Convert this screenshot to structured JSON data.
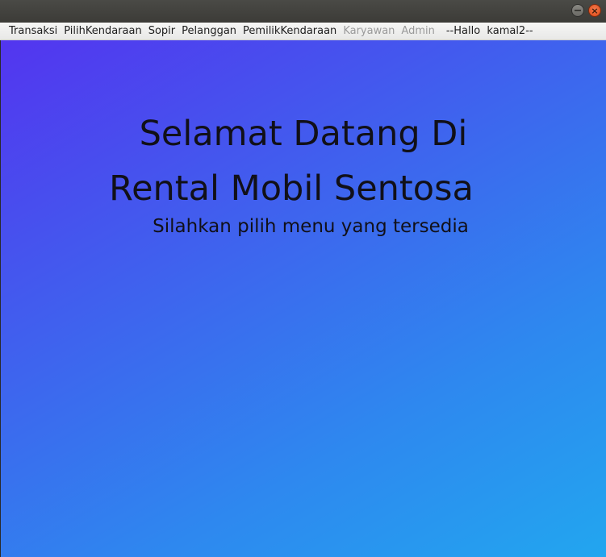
{
  "menubar": {
    "items": [
      {
        "label": "Transaksi",
        "enabled": true
      },
      {
        "label": "PilihKendaraan",
        "enabled": true
      },
      {
        "label": "Sopir",
        "enabled": true
      },
      {
        "label": "Pelanggan",
        "enabled": true
      },
      {
        "label": "PemilikKendaraan",
        "enabled": true
      },
      {
        "label": "Karyawan",
        "enabled": false
      },
      {
        "label": "Admin",
        "enabled": false
      }
    ],
    "greeting": "--Hallo  kamal2--"
  },
  "window_controls": {
    "minimize_icon": "minimize-icon",
    "close_icon": "close-icon",
    "close_glyph": "×"
  },
  "main": {
    "welcome_line1": "Selamat Datang Di",
    "welcome_line2": "Rental Mobil Sentosa",
    "subtitle": "Silahkan pilih menu yang tersedia"
  },
  "colors": {
    "gradient_start": "#5335ef",
    "gradient_end": "#22a6ef",
    "close_button": "#dd4814"
  }
}
